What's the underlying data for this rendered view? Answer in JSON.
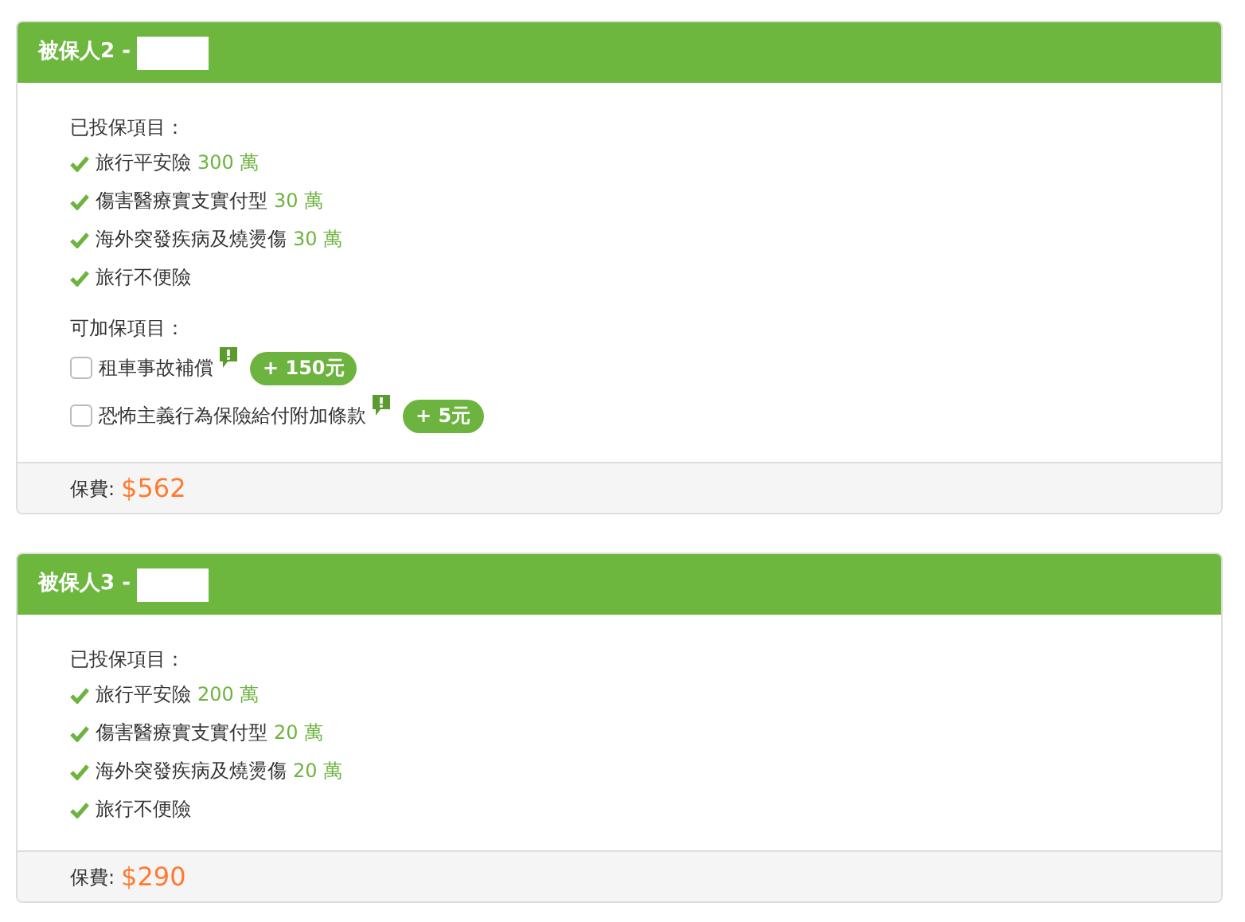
{
  "insured": [
    {
      "title": "被保人2 -",
      "covered_label": "已投保項目：",
      "covered": [
        {
          "name": "旅行平安險",
          "amount": "300 萬"
        },
        {
          "name": "傷害醫療實支實付型",
          "amount": "30 萬"
        },
        {
          "name": "海外突發疾病及燒燙傷",
          "amount": "30 萬"
        },
        {
          "name": "旅行不便險"
        }
      ],
      "addons_label": "可加保項目：",
      "addons": [
        {
          "name": "租車事故補償",
          "checked": false,
          "price": "+ 150元"
        },
        {
          "name": "恐怖主義行為保險給付附加條款",
          "checked": false,
          "price": "+ 5元"
        }
      ],
      "fee_label": "保費:",
      "fee": "$562"
    },
    {
      "title": "被保人3 -",
      "covered_label": "已投保項目：",
      "covered": [
        {
          "name": "旅行平安險",
          "amount": "200 萬"
        },
        {
          "name": "傷害醫療實支實付型",
          "amount": "20 萬"
        },
        {
          "name": "海外突發疾病及燒燙傷",
          "amount": "20 萬"
        },
        {
          "name": "旅行不便險"
        }
      ],
      "fee_label": "保費:",
      "fee": "$290"
    }
  ]
}
